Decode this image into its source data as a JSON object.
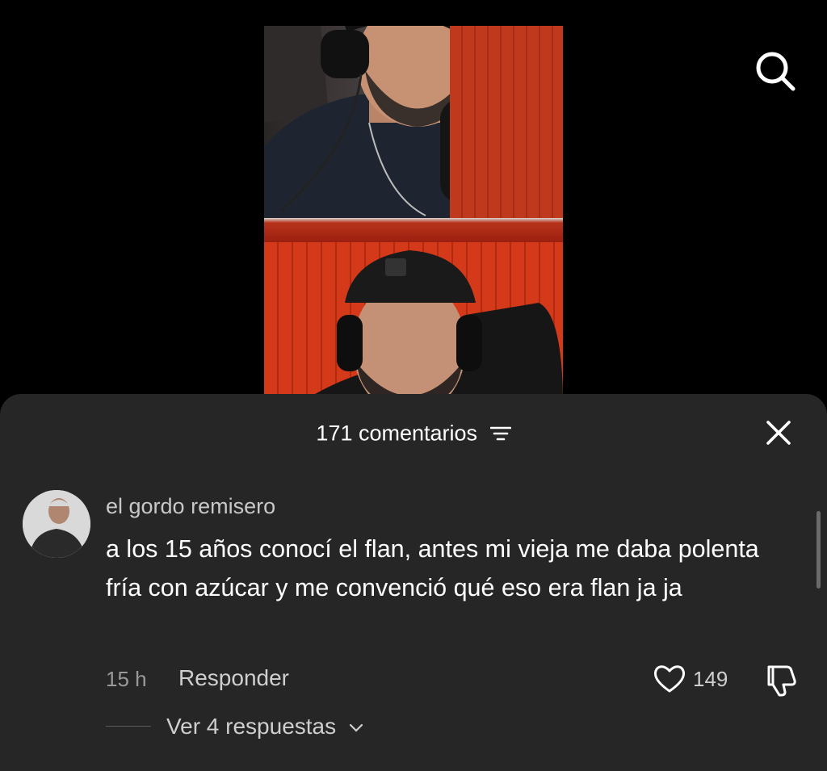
{
  "header": {
    "search_icon": "search-icon"
  },
  "sheet": {
    "title": "171 comentarios",
    "sort_icon": "sort-lines-icon",
    "close_icon": "close-icon"
  },
  "comment": {
    "username": "el gordo remisero",
    "text": "a los 15 años conocí el flan, antes mi vieja me daba polenta fría con azúcar y me convenció qué eso era flan ja ja",
    "time": "15 h",
    "reply_label": "Responder",
    "likes": "149",
    "view_replies_label": "Ver 4 respuestas"
  },
  "colors": {
    "sheet_bg": "#262626",
    "accent_red": "#c5401f",
    "text_muted": "#9a9a9a"
  }
}
